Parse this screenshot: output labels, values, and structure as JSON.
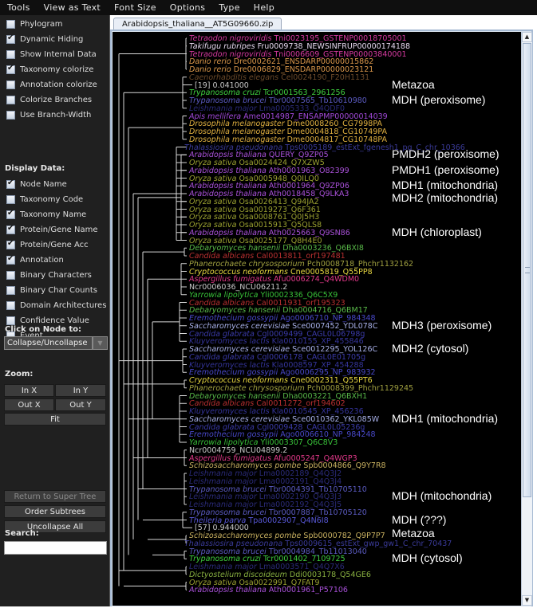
{
  "menu": [
    "Tools",
    "View as Text",
    "Font Size",
    "Options",
    "Type",
    "Help"
  ],
  "sidebar": {
    "options": [
      {
        "label": "Phylogram",
        "checked": false
      },
      {
        "label": "Dynamic Hiding",
        "checked": true
      },
      {
        "label": "Show Internal Data",
        "checked": false
      },
      {
        "label": "Taxonomy colorize",
        "checked": true
      },
      {
        "label": "Annotation colorize",
        "checked": false
      },
      {
        "label": "Colorize Branches",
        "checked": false
      },
      {
        "label": "Use Branch-Width",
        "checked": false
      }
    ],
    "display_data_label": "Display Data:",
    "display_data": [
      {
        "label": "Node Name",
        "checked": true
      },
      {
        "label": "Taxonomy Code",
        "checked": false
      },
      {
        "label": "Taxonomy Name",
        "checked": true
      },
      {
        "label": "Protein/Gene Name",
        "checked": true
      },
      {
        "label": "Protein/Gene Acc",
        "checked": true
      },
      {
        "label": "Annotation",
        "checked": true
      },
      {
        "label": "Binary Characters",
        "checked": false
      },
      {
        "label": "Binary Char Counts",
        "checked": false
      },
      {
        "label": "Domain Architectures",
        "checked": false
      },
      {
        "label": "Confidence Value",
        "checked": false
      },
      {
        "label": "Event",
        "checked": false
      }
    ],
    "click_on_node_label": "Click on Node to:",
    "click_on_node_value": "Collapse/Uncollapse",
    "zoom_label": "Zoom:",
    "zoom_buttons": {
      "in_x": "In X",
      "in_y": "In Y",
      "out_x": "Out X",
      "out_y": "Out Y",
      "fit": "Fit"
    },
    "return_button": "Return to Super Tree",
    "order_button": "Order Subtrees",
    "uncollapse_button": "Uncollapse All",
    "search_label": "Search:",
    "search_value": ""
  },
  "tab": {
    "label": "Arabidopsis_thaliana__AT5G09660.zip"
  },
  "colors": {
    "metazoa_pink": "#d63aa0",
    "takifugu_white": "#e6d8ee",
    "danio_orange": "#d8964a",
    "caenorhabditis_brown": "#6b4a2a",
    "collapsed_grey": "#c8c8c8",
    "trypanosoma_cruzi_green": "#3fd03f",
    "trypanosoma_brucei_blue": "#5a5ac0",
    "leishmania_dark": "#2a2a78",
    "apis_purple": "#a048d8",
    "drosophila_yellow": "#e0b040",
    "thalassiosira_blue": "#3a3a98",
    "arabidopsis_purple": "#a850d8",
    "oryza_olive": "#9aa030",
    "debaryomyces_green": "#58b848",
    "candida_albicans_red": "#b83030",
    "phanerochaete_olive": "#a0a040",
    "cryptococcus_yellow": "#e8d840",
    "aspergillus_magenta": "#e03888",
    "neurospora_grey": "#c8c8c8",
    "yarrowia_green": "#38c038",
    "eremothecium_blue": "#4848c8",
    "saccharomyces_lavender": "#a8b0e8",
    "candida_glabrata_blue": "#3a3aa8",
    "kluyveromyces_blue": "#34349a",
    "schizosaccharomyces_tan": "#c8b060",
    "theileria_blue": "#5858d8",
    "dictyostelium_green": "#88b040",
    "annotation_white": "#ffffff"
  },
  "leaves": [
    {
      "species": "Tetraodon nigroviridis",
      "id": "Tni0023195_GSTENP00018705001",
      "color": "#d63aa0"
    },
    {
      "species": "Takifugu rubripes",
      "id": "Fru0009738_NEWSINFRUP00000174188",
      "color": "#e6d8ee"
    },
    {
      "species": "Tetraodon nigroviridis",
      "id": "Tni0006609_GSTENP00003840001",
      "color": "#d63aa0"
    },
    {
      "species": "Danio rerio",
      "id": "Dre0002621_ENSDARP00000015862",
      "color": "#d8964a"
    },
    {
      "species": "Danio rerio",
      "id": "Dre0006829_ENSDARP00000023121",
      "color": "#d8964a"
    },
    {
      "species": "Caenorhabditis elegans",
      "id": "Cel0024190_F20H1131",
      "color": "#6b4a2a"
    },
    {
      "species": "",
      "id": "[19] 0.041000",
      "color": "#c8c8c8",
      "collapsed": true
    },
    {
      "species": "Trypanosoma cruzi",
      "id": "Tcr0001563_2961256",
      "color": "#3fd03f"
    },
    {
      "species": "Trypanosoma brucei",
      "id": "Tbr0007565_Tb10610980",
      "color": "#5a5ac0"
    },
    {
      "species": "Leishmania major",
      "id": "Lma0005333_Q4QDF0",
      "color": "#2a2a78"
    },
    {
      "species": "Apis mellifera",
      "id": "Ame0014987_ENSAPMP00000014039",
      "color": "#a048d8"
    },
    {
      "species": "Drosophila melanogaster",
      "id": "Dme0008260_CG7998PA",
      "color": "#e0b040"
    },
    {
      "species": "Drosophila melanogaster",
      "id": "Dme0004818_CG10749PA",
      "color": "#e0b040"
    },
    {
      "species": "Drosophila melanogaster",
      "id": "Dme0004817_CG10748PA",
      "color": "#e0b040"
    },
    {
      "species": "Thalassiosira pseudonana",
      "id": "Tps0005189_estExt_fgenesh1_pg_C_chr_10366",
      "color": "#3a3a98"
    },
    {
      "species": "Arabidopsis thaliana",
      "id": "QUERY_Q9ZP05",
      "color": "#a850d8"
    },
    {
      "species": "Oryza sativa",
      "id": "Osa0024424_Q7XZW5",
      "color": "#9aa030"
    },
    {
      "species": "Arabidopsis thaliana",
      "id": "Ath0001963_O82399",
      "color": "#a850d8"
    },
    {
      "species": "Oryza sativa",
      "id": "Osa0005948_Q0ILQ0",
      "color": "#9aa030"
    },
    {
      "species": "Arabidopsis thaliana",
      "id": "Ath0001964_Q9ZP06",
      "color": "#a850d8"
    },
    {
      "species": "Arabidopsis thaliana",
      "id": "Ath0018458_Q9LKA3",
      "color": "#a850d8"
    },
    {
      "species": "Oryza sativa",
      "id": "Osa0026413_Q94JA2",
      "color": "#9aa030"
    },
    {
      "species": "Oryza sativa",
      "id": "Osa0019273_Q6F361",
      "color": "#9aa030"
    },
    {
      "species": "Oryza sativa",
      "id": "Osa0008761_Q0J5H3",
      "color": "#9aa030"
    },
    {
      "species": "Oryza sativa",
      "id": "Osa0015913_Q5QLS8",
      "color": "#9aa030"
    },
    {
      "species": "Arabidopsis thaliana",
      "id": "Ath0025663_Q9SN86",
      "color": "#a850d8"
    },
    {
      "species": "Oryza sativa",
      "id": "Osa0025177_Q8H4E0",
      "color": "#9aa030"
    },
    {
      "species": "Debaryomyces hansenii",
      "id": "Dha0003236_Q6BXI8",
      "color": "#58b848"
    },
    {
      "species": "Candida albicans",
      "id": "Cal0013811_orf197481",
      "color": "#b83030"
    },
    {
      "species": "Phanerochaete chrysosporium",
      "id": "Pch0008718_Phchr1132162",
      "color": "#a0a040"
    },
    {
      "species": "Cryptococcus neoformans",
      "id": "Cne0005819_Q55PP8",
      "color": "#e8d840"
    },
    {
      "species": "Aspergillus fumigatus",
      "id": "Afu0006274_Q4WDM0",
      "color": "#e03888"
    },
    {
      "species": "",
      "id": "Ncr0006036_NCU06211.2",
      "color": "#c8c8c8"
    },
    {
      "species": "Yarrowia lipolytica",
      "id": "Yli0002336_Q6C5X9",
      "color": "#38c038"
    },
    {
      "species": "Candida albicans",
      "id": "Cal0011931_orf195323",
      "color": "#b83030"
    },
    {
      "species": "Debaryomyces hansenii",
      "id": "Dha0004716_Q6BM17",
      "color": "#58b848"
    },
    {
      "species": "Eremothecium gossypii",
      "id": "Ago0006710_NP_984348",
      "color": "#4848c8"
    },
    {
      "species": "Saccharomyces cerevisiae",
      "id": "Sce0007452_YDL078C",
      "color": "#a8b0e8"
    },
    {
      "species": "Candida glabrata",
      "id": "Cgl0009499_CAGL0L06798g",
      "color": "#3a3aa8"
    },
    {
      "species": "Kluyveromyces lactis",
      "id": "Kla0010155_XP_455846",
      "color": "#34349a"
    },
    {
      "species": "Saccharomyces cerevisiae",
      "id": "Sce0012295_YOL126C",
      "color": "#a8b0e8"
    },
    {
      "species": "Candida glabrata",
      "id": "Cgl0006178_CAGL0E01705g",
      "color": "#3a3aa8"
    },
    {
      "species": "Kluyveromyces lactis",
      "id": "Kla0008597_XP_454288",
      "color": "#34349a"
    },
    {
      "species": "Eremothecium gossypii",
      "id": "Ago0006295_NP_983932",
      "color": "#4848c8"
    },
    {
      "species": "Cryptococcus neoformans",
      "id": "Cne0002311_Q55PT6",
      "color": "#e8d840"
    },
    {
      "species": "Phanerochaete chrysosporium",
      "id": "Pch0008399_Phchr1129245",
      "color": "#a0a040"
    },
    {
      "species": "Debaryomyces hansenii",
      "id": "Dha0003221_Q6BXH1",
      "color": "#58b848"
    },
    {
      "species": "Candida albicans",
      "id": "Cal0011272_orf194602",
      "color": "#b83030"
    },
    {
      "species": "Kluyveromyces lactis",
      "id": "Kla0010545_XP_456236",
      "color": "#34349a"
    },
    {
      "species": "Saccharomyces cerevisiae",
      "id": "Sce0010362_YKL085W",
      "color": "#a8b0e8"
    },
    {
      "species": "Candida glabrata",
      "id": "Cgl0009428_CAGL0L05236g",
      "color": "#3a3aa8"
    },
    {
      "species": "Eremothecium gossypii",
      "id": "Ago0006610_NP_984248",
      "color": "#4848c8"
    },
    {
      "species": "Yarrowia lipolytica",
      "id": "Yli0003307_Q6C8V3",
      "color": "#38c038"
    },
    {
      "species": "",
      "id": "Ncr0004759_NCU04899.2",
      "color": "#c8c8c8"
    },
    {
      "species": "Aspergillus fumigatus",
      "id": "Afu0005247_Q4WGP3",
      "color": "#e03888"
    },
    {
      "species": "Schizosaccharomyces pombe",
      "id": "Spb0004866_Q9Y7R8",
      "color": "#c8b060"
    },
    {
      "species": "Leishmania major",
      "id": "Lma0002189_Q4Q3J2",
      "color": "#2a2a78"
    },
    {
      "species": "Leishmania major",
      "id": "Lma0002191_Q4Q3J4",
      "color": "#2a2a78"
    },
    {
      "species": "Trypanosoma brucei",
      "id": "Tbr0004391_Tb10705110",
      "color": "#5a5ac0"
    },
    {
      "species": "Leishmania major",
      "id": "Lma0002190_Q4Q3J3",
      "color": "#2a2a78"
    },
    {
      "species": "Leishmania major",
      "id": "Lma0002192_Q4Q3J5",
      "color": "#2a2a78"
    },
    {
      "species": "Trypanosoma brucei",
      "id": "Tbr0007887_Tb10705120",
      "color": "#5a5ac0"
    },
    {
      "species": "Theileria parva",
      "id": "Tpa0002907_Q4N6I8",
      "color": "#5858d8"
    },
    {
      "species": "",
      "id": "[57] 0.944000",
      "color": "#c8c8c8",
      "collapsed": true
    },
    {
      "species": "Schizosaccharomyces pombe",
      "id": "Spb0000782_Q9P7P7",
      "color": "#c8b060"
    },
    {
      "species": "Thalassiosira pseudonana",
      "id": "Tps0009615_estExt_gwp_gw1_C_chr_70437",
      "color": "#3a3a98"
    },
    {
      "species": "Trypanosoma brucei",
      "id": "Tbr0004984_Tb11013040",
      "color": "#5a5ac0"
    },
    {
      "species": "Trypanosoma cruzi",
      "id": "Tcr0001402_7109725",
      "color": "#3fd03f"
    },
    {
      "species": "Leishmania major",
      "id": "Lma0003571_Q4Q7X6",
      "color": "#2a2a78"
    },
    {
      "species": "Dictyostelium discoideum",
      "id": "Ddi0003178_Q54GE6",
      "color": "#88b040"
    },
    {
      "species": "Oryza sativa",
      "id": "Osa0022991_Q7FAT9",
      "color": "#9aa030"
    },
    {
      "species": "Arabidopsis thaliana",
      "id": "Ath0001961_P57106",
      "color": "#a850d8"
    }
  ],
  "annotations": [
    {
      "text": "Metazoa",
      "row": 6
    },
    {
      "text": "MDH (peroxisome)",
      "row": 8
    },
    {
      "text": "PMDH2 (peroxisome)",
      "row": 15
    },
    {
      "text": "PMDH1 (peroxisome)",
      "row": 17
    },
    {
      "text": "MDH1 (mitochondria)",
      "row": 19
    },
    {
      "text": "MDH2 (mitochondria)",
      "row": 20.6
    },
    {
      "text": "MDH (chloroplast)",
      "row": 25
    },
    {
      "text": "MDH3 (peroxisome)",
      "row": 37
    },
    {
      "text": "MDH2 (cytosol)",
      "row": 40
    },
    {
      "text": "MDH1 (mitochondria)",
      "row": 49
    },
    {
      "text": "MDH (mitochondria)",
      "row": 59
    },
    {
      "text": "MDH (???)",
      "row": 62
    },
    {
      "text": "Metazoa",
      "row": 63.8
    },
    {
      "text": "MDH (cytosol)",
      "row": 67
    }
  ]
}
